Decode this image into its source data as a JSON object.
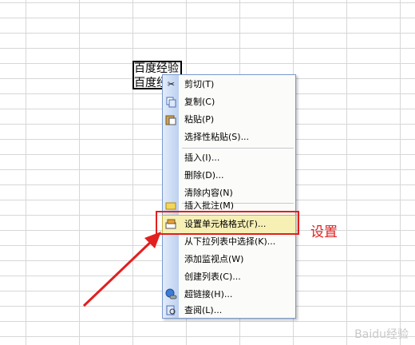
{
  "cells": {
    "row1": "百度经验",
    "row2": "百度经验"
  },
  "menu": {
    "items": [
      {
        "label": "剪切(T)",
        "icon": "scissors-icon"
      },
      {
        "label": "复制(C)",
        "icon": "copy-icon"
      },
      {
        "label": "粘贴(P)",
        "icon": "paste-icon"
      },
      {
        "label": "选择性粘贴(S)...",
        "icon": ""
      },
      {
        "label": "插入(I)...",
        "icon": ""
      },
      {
        "label": "删除(D)...",
        "icon": ""
      },
      {
        "label": "清除内容(N)",
        "icon": ""
      },
      {
        "label": "插入批注(M)",
        "icon": "comment-icon"
      },
      {
        "label": "设置单元格格式(F)...",
        "icon": "format-cells-icon"
      },
      {
        "label": "从下拉列表中选择(K)...",
        "icon": ""
      },
      {
        "label": "添加监视点(W)",
        "icon": ""
      },
      {
        "label": "创建列表(C)...",
        "icon": ""
      },
      {
        "label": "超链接(H)...",
        "icon": "hyperlink-icon"
      },
      {
        "label": "查阅(L)...",
        "icon": "research-icon"
      }
    ]
  },
  "annotation": {
    "label": "设置",
    "color": "#e21f1f"
  },
  "watermark": "Baidu经验"
}
